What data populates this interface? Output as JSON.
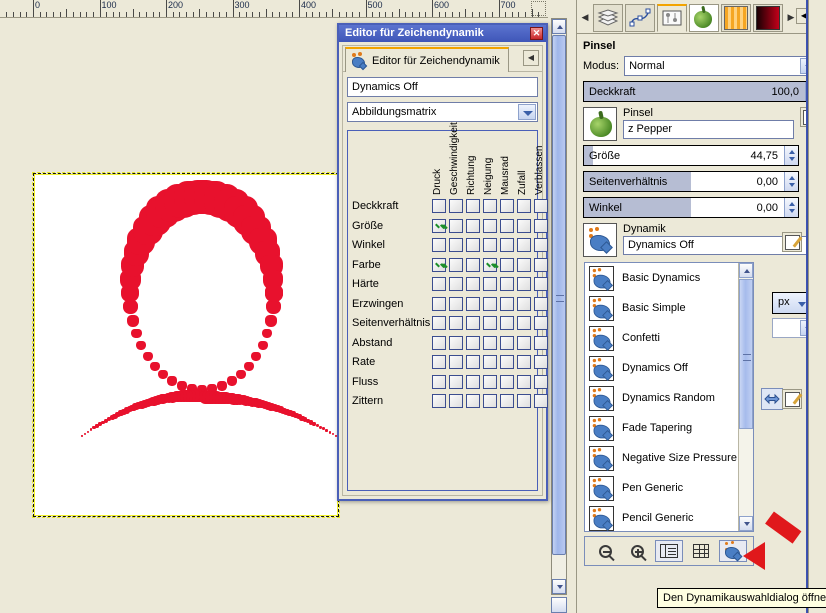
{
  "canvas": {
    "ruler": {
      "unit_marks": [
        "0",
        "100",
        "200",
        "300",
        "400",
        "500",
        "600",
        "700"
      ],
      "marker_icon": "ruler-position-marker",
      "corner_icon": "zoom-follow-window-icon"
    },
    "artwork_alt": "red pepper brush stroke loop"
  },
  "dynamics_editor": {
    "title": "Editor für Zeichendynamik",
    "close_icon": "close-icon",
    "tab_label": "Editor für Zeichendynamik",
    "tab_icon": "dynamics-icon",
    "collapse_icon": "collapse-tab-icon",
    "name_value": "Dynamics Off",
    "view_mode": "Abbildungsmatrix",
    "columns": [
      "Druck",
      "Geschwindigkeit",
      "Richtung",
      "Neigung",
      "Mausrad",
      "Zufall",
      "Verblassen"
    ],
    "rows": [
      {
        "label": "Deckkraft",
        "checks": [
          false,
          false,
          false,
          false,
          false,
          false,
          false
        ]
      },
      {
        "label": "Größe",
        "checks": [
          true,
          false,
          false,
          false,
          false,
          false,
          false
        ]
      },
      {
        "label": "Winkel",
        "checks": [
          false,
          false,
          false,
          false,
          false,
          false,
          false
        ]
      },
      {
        "label": "Farbe",
        "checks": [
          true,
          false,
          false,
          true,
          false,
          false,
          false
        ]
      },
      {
        "label": "Härte",
        "checks": [
          false,
          false,
          false,
          false,
          false,
          false,
          false
        ]
      },
      {
        "label": "Erzwingen",
        "checks": [
          false,
          false,
          false,
          false,
          false,
          false,
          false
        ]
      },
      {
        "label": "Seitenverhältnis",
        "checks": [
          false,
          false,
          false,
          false,
          false,
          false,
          false
        ]
      },
      {
        "label": "Abstand",
        "checks": [
          false,
          false,
          false,
          false,
          false,
          false,
          false
        ]
      },
      {
        "label": "Rate",
        "checks": [
          false,
          false,
          false,
          false,
          false,
          false,
          false
        ]
      },
      {
        "label": "Fluss",
        "checks": [
          false,
          false,
          false,
          false,
          false,
          false,
          false
        ]
      },
      {
        "label": "Zittern",
        "checks": [
          false,
          false,
          false,
          false,
          false,
          false,
          false
        ]
      }
    ]
  },
  "dock": {
    "tabs": [
      {
        "name": "layers-tab",
        "icon": "layers-icon",
        "active": false
      },
      {
        "name": "paths-tab",
        "icon": "paths-icon",
        "active": false
      },
      {
        "name": "tool-options-tab",
        "icon": "tool-options-icon",
        "active": true
      },
      {
        "name": "brushes-tab",
        "icon": "pepper-brush-icon",
        "active": false
      },
      {
        "name": "patterns-tab",
        "icon": "pattern-icon",
        "active": false
      },
      {
        "name": "gradients-tab",
        "icon": "gradient-icon",
        "active": false
      }
    ],
    "tab_scroll_left_icon": "chevron-left-icon",
    "tab_scroll_right_icon": "chevron-right-icon",
    "collapse_icon": "collapse-dock-icon",
    "section_title": "Pinsel",
    "mode_label": "Modus:",
    "mode_value": "Normal",
    "opacity": {
      "label": "Deckkraft",
      "value": "100,0",
      "fill_percent": 100
    },
    "brush": {
      "label": "Pinsel",
      "value": "z Pepper",
      "icon": "pepper-brush-icon",
      "edit_icon": "edit-brush-icon"
    },
    "size": {
      "label": "Größe",
      "value": "44,75",
      "fill_percent": 4,
      "reset_icon": "reset-icon"
    },
    "aspect": {
      "label": "Seitenverhältnis",
      "value": "0,00",
      "fill_percent": 50,
      "reset_icon": "reset-icon"
    },
    "angle": {
      "label": "Winkel",
      "value": "0,00",
      "fill_percent": 50,
      "reset_icon": "reset-icon"
    },
    "dynamics": {
      "label": "Dynamik",
      "value": "Dynamics Off",
      "icon": "dynamics-icon",
      "edit_icon": "edit-dynamics-icon"
    },
    "unit_value": "px",
    "swap_icon": "swap-colors-icon"
  },
  "dynamics_popup": {
    "items": [
      {
        "label": "Basic Dynamics",
        "icon": "dynamics-icon"
      },
      {
        "label": "Basic Simple",
        "icon": "dynamics-icon"
      },
      {
        "label": "Confetti",
        "icon": "dynamics-icon"
      },
      {
        "label": "Dynamics Off",
        "icon": "dynamics-icon"
      },
      {
        "label": "Dynamics Random",
        "icon": "dynamics-icon"
      },
      {
        "label": "Fade Tapering",
        "icon": "dynamics-icon"
      },
      {
        "label": "Negative Size Pressure",
        "icon": "dynamics-icon"
      },
      {
        "label": "Pen Generic",
        "icon": "dynamics-icon"
      },
      {
        "label": "Pencil Generic",
        "icon": "dynamics-icon"
      }
    ],
    "scroll_up_icon": "scroll-up-icon",
    "scroll_down_icon": "scroll-down-icon",
    "toolbar": [
      {
        "name": "zoom-out-button",
        "icon": "zoom-out-icon"
      },
      {
        "name": "zoom-in-button",
        "icon": "zoom-in-icon"
      },
      {
        "name": "list-view-button",
        "icon": "list-view-icon"
      },
      {
        "name": "grid-view-button",
        "icon": "grid-view-icon"
      },
      {
        "name": "open-dynamics-dialog-button",
        "icon": "dynamics-icon"
      }
    ]
  },
  "tooltip": {
    "text": "Den Dynamikauswahldialog öffnen"
  },
  "annotation": {
    "arrow_icon": "red-arrow-pointer",
    "color": "#e0181b"
  },
  "colors": {
    "title_bar": "#4a5fb8",
    "accent_tab": "#f3a400",
    "brush_red": "#e8112d",
    "tooltip_bg": "#ffffe1",
    "window_bg": "#ece9d8"
  }
}
